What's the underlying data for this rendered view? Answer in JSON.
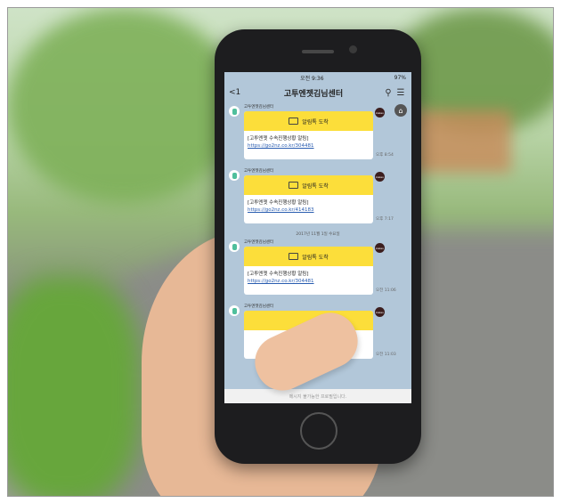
{
  "status_bar": {
    "time": "오전 9:36",
    "battery": "97%"
  },
  "header": {
    "back_label": "<1",
    "title": "고투엔젯김님센터",
    "search_icon": "search-icon",
    "menu_icon": "menu-icon"
  },
  "messages": [
    {
      "sender": "고투엔젯김님센터",
      "card_title": "알림톡 도착",
      "body": "[고투엔젯 수속진행상황 알림]",
      "link": "https://go2nz.co.kr/304481",
      "badge": "kakao",
      "time": "오후 8:54"
    },
    {
      "sender": "고투엔젯김님센터",
      "card_title": "알림톡 도착",
      "body": "[고투엔젯 수속진행상황 알림]",
      "link": "https://go2nz.co.kr/414183",
      "badge": "kakao",
      "time": "오후 7:17"
    },
    {
      "sender": "고투엔젯김님센터",
      "card_title": "알림톡 도착",
      "body": "[고투엔젯 수속진행상황 알림]",
      "link": "https://go2nz.co.kr/304481",
      "badge": "kakao",
      "time": "오전 11:06"
    },
    {
      "sender": "고투엔젯김님센터",
      "card_title": "",
      "body": "",
      "link": "",
      "badge": "kakao",
      "time": "오전 11:03"
    }
  ],
  "date_divider": "2017년 11월 1일 수요일",
  "input_placeholder": "메시지 불가능한 프로필입니다.",
  "colors": {
    "chat_bg": "#b2c7d9",
    "card_header": "#fcde3a",
    "link": "#2a5db0"
  }
}
